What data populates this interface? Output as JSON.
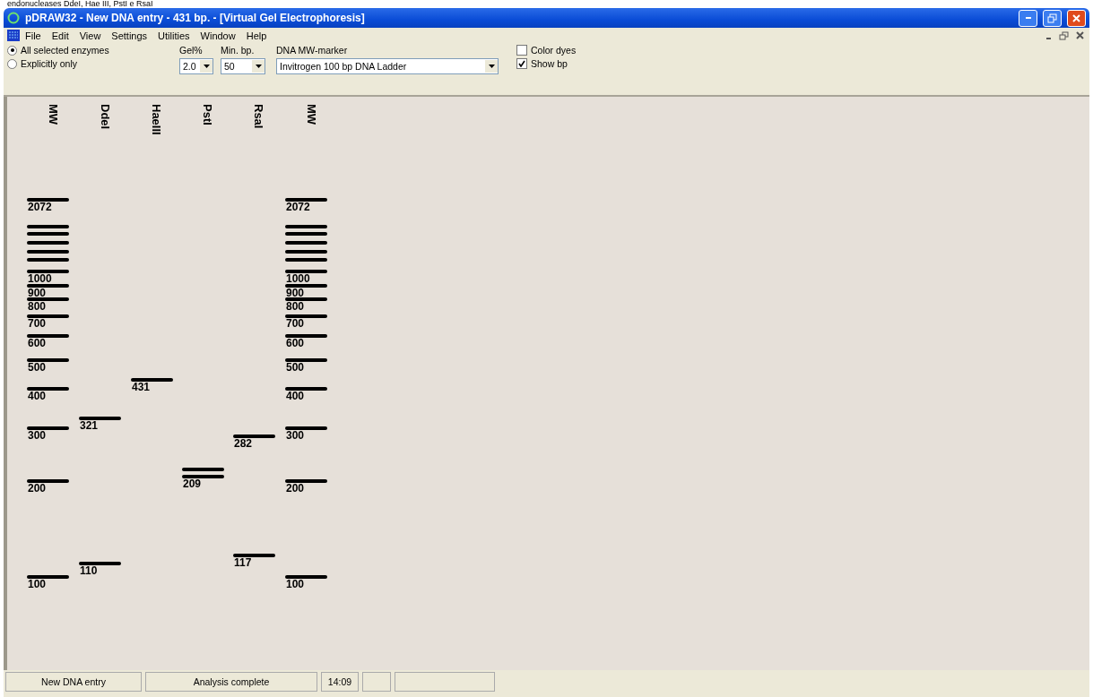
{
  "caption": "endonucleases DdeI, Hae III, PstI e RsaI",
  "window": {
    "title": "pDRAW32 - New DNA entry - 431 bp. - [Virtual Gel Electrophoresis]"
  },
  "menu": [
    "File",
    "Edit",
    "View",
    "Settings",
    "Utilities",
    "Window",
    "Help"
  ],
  "toolbar": {
    "radios": [
      {
        "label": "All selected enzymes",
        "selected": true
      },
      {
        "label": "Explicitly only",
        "selected": false
      }
    ],
    "dropdowns": [
      {
        "label": "Gel%",
        "value": "2.0"
      },
      {
        "label": "Min. bp.",
        "value": "50"
      },
      {
        "label": "DNA MW-marker",
        "value": "Invitrogen 100 bp DNA Ladder"
      }
    ],
    "checkboxes": [
      {
        "label": "Color dyes",
        "checked": false
      },
      {
        "label": "Show bp",
        "checked": true
      }
    ]
  },
  "lanes": [
    {
      "name": "MW",
      "bands": [
        {
          "kind": "labeled",
          "label": "2072"
        },
        {
          "kind": "plain"
        },
        {
          "kind": "plain"
        },
        {
          "kind": "plain"
        },
        {
          "kind": "plain"
        },
        {
          "kind": "plain"
        },
        {
          "kind": "labeled",
          "label": "1000"
        },
        {
          "kind": "labeled",
          "label": "900"
        },
        {
          "kind": "labeled",
          "label": "800"
        },
        {
          "kind": "labeled",
          "label": "700"
        },
        {
          "kind": "labeled",
          "label": "600"
        },
        {
          "kind": "labeled",
          "label": "500"
        },
        {
          "kind": "labeled",
          "label": "400"
        },
        {
          "kind": "labeled",
          "label": "300"
        },
        {
          "kind": "labeled",
          "label": "200"
        },
        {
          "kind": "labeled",
          "label": "100"
        }
      ]
    },
    {
      "name": "DdeI",
      "bands": [
        {
          "kind": "labeled",
          "label": "321"
        },
        {
          "kind": "labeled",
          "label": "110"
        }
      ]
    },
    {
      "name": "HaeIII",
      "bands": [
        {
          "kind": "labeled",
          "label": "431"
        }
      ]
    },
    {
      "name": "PstI",
      "bands": [
        {
          "kind": "plain"
        },
        {
          "kind": "labeled",
          "label": "209"
        }
      ]
    },
    {
      "name": "RsaI",
      "bands": [
        {
          "kind": "labeled",
          "label": "282"
        },
        {
          "kind": "labeled",
          "label": "117"
        }
      ]
    },
    {
      "name": "MW",
      "bands": [
        {
          "kind": "labeled",
          "label": "2072"
        },
        {
          "kind": "plain"
        },
        {
          "kind": "plain"
        },
        {
          "kind": "plain"
        },
        {
          "kind": "plain"
        },
        {
          "kind": "plain"
        },
        {
          "kind": "labeled",
          "label": "1000"
        },
        {
          "kind": "labeled",
          "label": "900"
        },
        {
          "kind": "labeled",
          "label": "800"
        },
        {
          "kind": "labeled",
          "label": "700"
        },
        {
          "kind": "labeled",
          "label": "600"
        },
        {
          "kind": "labeled",
          "label": "500"
        },
        {
          "kind": "labeled",
          "label": "400"
        },
        {
          "kind": "labeled",
          "label": "300"
        },
        {
          "kind": "labeled",
          "label": "200"
        },
        {
          "kind": "labeled",
          "label": "100"
        }
      ]
    }
  ],
  "status_bar": [
    "New DNA entry",
    "Analysis complete",
    "14:09"
  ]
}
